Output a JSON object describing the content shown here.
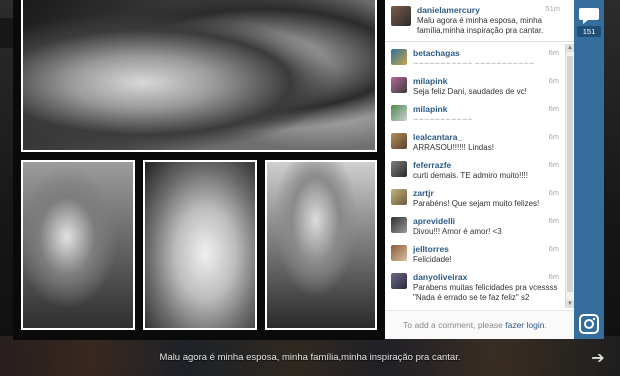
{
  "caption": "Malu agora é minha esposa, minha família,minha inspiração pra cantar.",
  "colors": {
    "link": "#2c5a85",
    "sidebar": "#356d9d",
    "badge": "#1f4f79"
  },
  "sidebar": {
    "comment_count": "151",
    "comment_icon": "speech-bubble-icon",
    "app_icon": "instagram-icon"
  },
  "post": {
    "username": "danielamercury",
    "time": "51m",
    "text": "Malu agora é minha esposa, minha família,minha inspiração pra cantar."
  },
  "comments": [
    {
      "username": "betachagas",
      "time": "6m",
      "text": "ꕀꕀꕀꕀꕀꕀꕀꕀꕀꕀꕀ ꕀꕀꕀꕀꕀꕀꕀꕀꕀꕀꕀ"
    },
    {
      "username": "milapink",
      "time": "6m",
      "text": "Seja feliz Dani, saudades de vc!"
    },
    {
      "username": "milapink",
      "time": "6m",
      "text": "ꕀꕀꕀꕀꕀꕀꕀꕀꕀꕀꕀ"
    },
    {
      "username": "lealcantara_",
      "time": "6m",
      "text": "ARRASOU!!!!!! Lindas!"
    },
    {
      "username": "feferrazfe",
      "time": "6m",
      "text": "curti demais. TE admiro muito!!!!"
    },
    {
      "username": "zartjr",
      "time": "6m",
      "text": "Parabéns! Que sejam muito felizes!"
    },
    {
      "username": "aprevidelli",
      "time": "6m",
      "text": "Divou!!! Amor é amor! <3"
    },
    {
      "username": "jelltorres",
      "time": "6m",
      "text": "Felicidade!"
    },
    {
      "username": "danyoliveirax",
      "time": "6m",
      "text": "Parabens muitas felicidades pra vcessss \"Nada é errado se te faz feliz\" s2"
    }
  ],
  "footer": {
    "prefix": "To add a comment, please ",
    "link": "fazer login",
    "suffix": "."
  }
}
